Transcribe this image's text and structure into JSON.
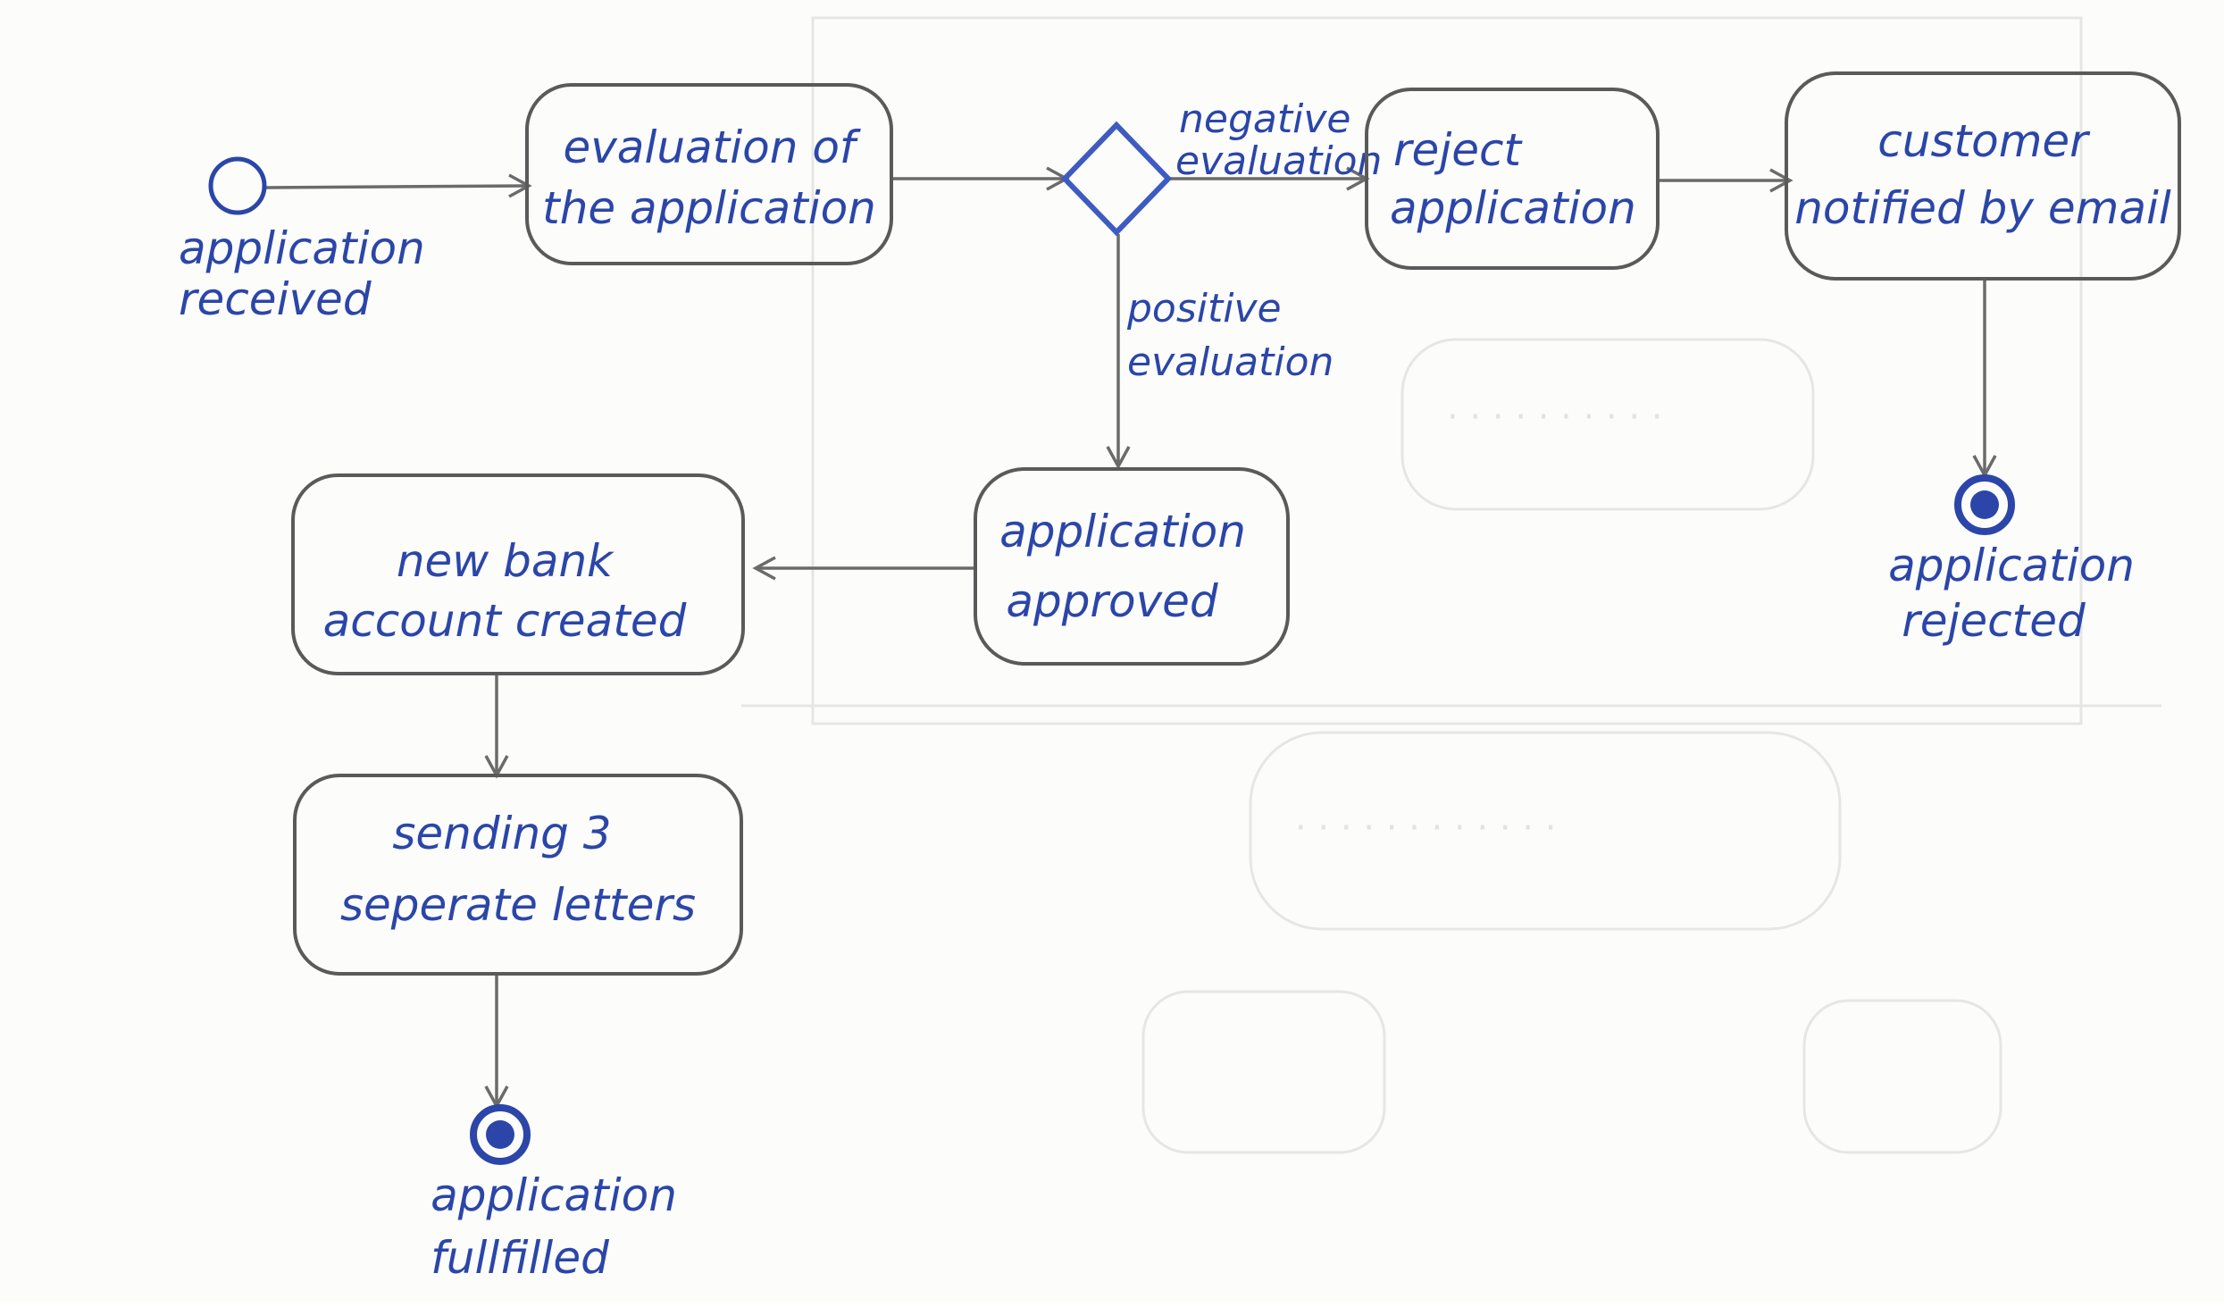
{
  "colors": {
    "ink": "#2b46a8",
    "line": "#6b6b6b",
    "paper": "#fcfcfb"
  },
  "nodes": {
    "start": {
      "label_line1": "application",
      "label_line2": "received"
    },
    "evaluation": {
      "line1": "evaluation of",
      "line2": "the application"
    },
    "reject": {
      "line1": "reject",
      "line2": "application"
    },
    "customer": {
      "line1": "customer",
      "line2": "notified by email"
    },
    "rejected_end": {
      "label_line1": "application",
      "label_line2": "rejected"
    },
    "approved": {
      "line1": "application",
      "line2": "approved"
    },
    "account": {
      "line1": "new bank",
      "line2": "account created"
    },
    "letters": {
      "line1": "sending 3",
      "line2": "seperate letters"
    },
    "fulfilled_end": {
      "label_line1": "application",
      "label_line2": "fullfilled"
    }
  },
  "decision": {
    "negative": {
      "line1": "negative",
      "line2": "evaluation"
    },
    "positive": {
      "line1": "positive",
      "line2": "evaluation"
    }
  }
}
